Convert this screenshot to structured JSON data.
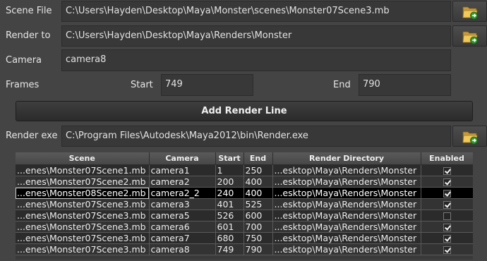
{
  "scene_file": {
    "label": "Scene File",
    "value": "C:\\Users\\Hayden\\Desktop\\Maya\\Monster\\scenes\\Monster07Scene3.mb",
    "browse_icon": "folder-arrow-icon"
  },
  "render_to": {
    "label": "Render to",
    "value": "C:\\Users\\Hayden\\Desktop\\Maya\\Renders\\Monster",
    "browse_icon": "folder-arrow-icon"
  },
  "camera": {
    "label": "Camera",
    "value": "camera8"
  },
  "frames": {
    "label": "Frames",
    "start_label": "Start",
    "start_value": "749",
    "end_label": "End",
    "end_value": "790"
  },
  "add_render_line": {
    "label": "Add Render Line"
  },
  "render_exe": {
    "label": "Render exe",
    "value": "C:\\Program Files\\Autodesk\\Maya2012\\bin\\Render.exe",
    "browse_icon": "folder-arrow-icon"
  },
  "table": {
    "headers": [
      "Scene",
      "Camera",
      "Start",
      "End",
      "Render Directory",
      "Enabled"
    ],
    "rows": [
      {
        "scene": "...enes\\Monster07Scene1.mb",
        "camera": "camera1",
        "start": "1",
        "end": "250",
        "dir": "...esktop\\Maya\\Renders\\Monster",
        "enabled": true
      },
      {
        "scene": "...enes\\Monster07Scene2.mb",
        "camera": "camera2",
        "start": "200",
        "end": "400",
        "dir": "...esktop\\Maya\\Renders\\Monster",
        "enabled": true
      },
      {
        "scene": "...enes\\Monster08Scene2.mb",
        "camera": "camera2_2",
        "start": "240",
        "end": "400",
        "dir": "...esktop\\Maya\\Renders\\Monster",
        "enabled": true
      },
      {
        "scene": "...enes\\Monster07Scene3.mb",
        "camera": "camera3",
        "start": "401",
        "end": "525",
        "dir": "...esktop\\Maya\\Renders\\Monster",
        "enabled": true
      },
      {
        "scene": "...enes\\Monster07Scene3.mb",
        "camera": "camera5",
        "start": "526",
        "end": "600",
        "dir": "...esktop\\Maya\\Renders\\Monster",
        "enabled": false
      },
      {
        "scene": "...enes\\Monster07Scene3.mb",
        "camera": "camera6",
        "start": "601",
        "end": "700",
        "dir": "...esktop\\Maya\\Renders\\Monster",
        "enabled": true
      },
      {
        "scene": "...enes\\Monster07Scene3.mb",
        "camera": "camera7",
        "start": "680",
        "end": "750",
        "dir": "...esktop\\Maya\\Renders\\Monster",
        "enabled": true
      },
      {
        "scene": "...enes\\Monster07Scene3.mb",
        "camera": "camera8",
        "start": "749",
        "end": "790",
        "dir": "...esktop\\Maya\\Renders\\Monster",
        "enabled": true
      }
    ],
    "selected_row": 2
  },
  "colors": {
    "background": "#444444",
    "field": "#383838",
    "selected_row": "#000000",
    "row_dark": "#2b2b2b",
    "row_alt": "#333333"
  }
}
